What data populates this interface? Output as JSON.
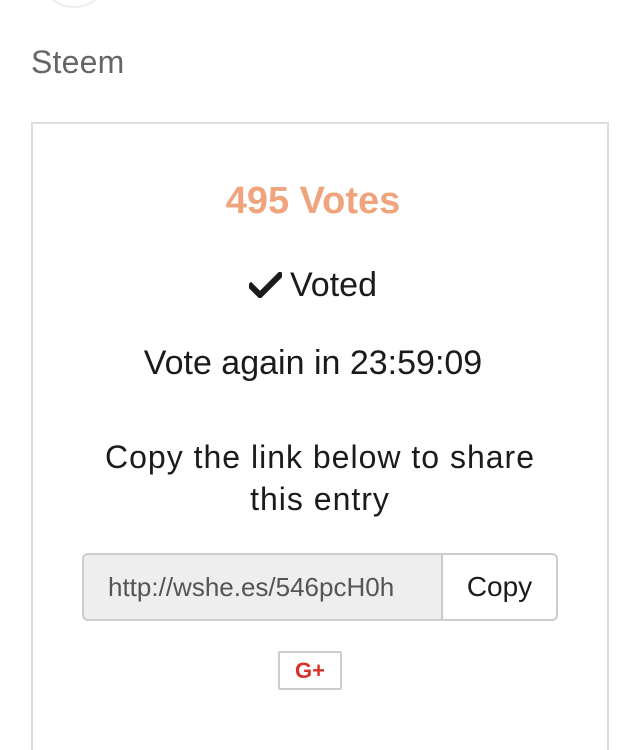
{
  "header": {
    "label": "Steem"
  },
  "vote_card": {
    "vote_count": "495 Votes",
    "voted_label": "Voted",
    "countdown": "Vote again in 23:59:09",
    "share_instructions": "Copy the link below to share this entry",
    "share_link": "http://wshe.es/546pcH0h",
    "copy_label": "Copy",
    "gplus_label": "G+",
    "check_icon": "checkmark-icon"
  },
  "colors": {
    "vote_count": "#f0a47e",
    "gplus": "#d6322a",
    "border": "#dddddd"
  }
}
